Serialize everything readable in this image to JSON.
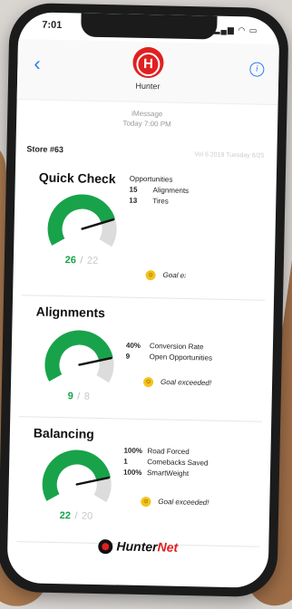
{
  "status_bar": {
    "time": "7:01",
    "icons": "▂▄▆ ◠ ▭"
  },
  "header": {
    "contact_name": "Hunter",
    "avatar_letter": "H",
    "back_glyph": "‹",
    "info_glyph": "i"
  },
  "meta": {
    "service": "iMessage",
    "timestamp": "Today 7:00 PM"
  },
  "store": {
    "label": "Store #63",
    "right_text": "Vol 6 2019 Tuesday 6/25"
  },
  "sections": [
    {
      "title": "Quick Check",
      "header_text": "Opportunities",
      "stats": [
        {
          "num": "15",
          "label": "Alignments"
        },
        {
          "num": "13",
          "label": "Tires"
        }
      ],
      "gauge_value": "26",
      "gauge_target": "22",
      "gauge_fraction": 0.8,
      "goal_text": "Goal exceeded!"
    },
    {
      "title": "Alignments",
      "stats": [
        {
          "num": "40%",
          "label": "Conversion Rate"
        },
        {
          "num": "9",
          "label": "Open Opportunities"
        }
      ],
      "gauge_value": "9",
      "gauge_target": "8",
      "gauge_fraction": 0.82,
      "goal_text": "Goal exceeded!"
    },
    {
      "title": "Balancing",
      "stats": [
        {
          "num": "100%",
          "label": "Road Forced"
        },
        {
          "num": "1",
          "label": "Comebacks Saved"
        },
        {
          "num": "100%",
          "label": "SmartWeight"
        }
      ],
      "gauge_value": "22",
      "gauge_target": "20",
      "gauge_fraction": 0.82,
      "goal_text": "Goal exceeded!"
    }
  ],
  "footer": {
    "brand_a": "Hunter",
    "brand_b": "Net"
  },
  "colors": {
    "gauge_green": "#18a34a",
    "gauge_track": "#dcdcdc",
    "accent_blue": "#2e7cf6",
    "brand_red": "#e02020",
    "goal_yellow": "#f4c21c"
  }
}
